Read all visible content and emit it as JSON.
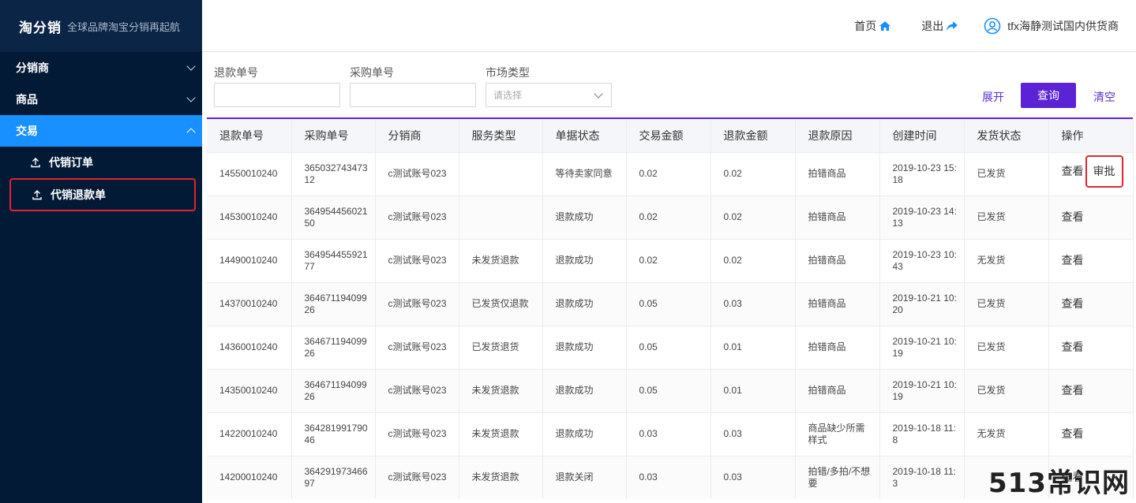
{
  "brand": {
    "logo": "淘分销",
    "subtitle": "全球品牌淘宝分销再起航"
  },
  "sidebar": {
    "groups": [
      {
        "label": "分销商"
      },
      {
        "label": "商品"
      },
      {
        "label": "交易"
      }
    ],
    "sub_items": [
      {
        "label": "代销订单"
      },
      {
        "label": "代销退款单"
      }
    ]
  },
  "header": {
    "home": "首页",
    "logout": "退出",
    "user": "tfx海静测试国内供货商"
  },
  "filters": {
    "refund_no_label": "退款单号",
    "purchase_no_label": "采购单号",
    "market_type_label": "市场类型",
    "market_type_placeholder": "请选择",
    "expand": "展开",
    "query": "查询",
    "clear": "清空"
  },
  "table": {
    "columns": [
      "退款单号",
      "采购单号",
      "分销商",
      "服务类型",
      "单据状态",
      "交易金额",
      "退款金额",
      "退款原因",
      "创建时间",
      "发货状态",
      "操作"
    ],
    "view_label": "查看",
    "approve_label": "审批",
    "rows": [
      [
        "14550010240",
        "36503274347312",
        "c测试账号023",
        "",
        "等待卖家同意",
        "0.02",
        "0.02",
        "拍错商品",
        "2019-10-23 15:18",
        "已发货"
      ],
      [
        "14530010240",
        "36495445602150",
        "c测试账号023",
        "",
        "退款成功",
        "0.02",
        "0.02",
        "拍错商品",
        "2019-10-23 14:13",
        "已发货"
      ],
      [
        "14490010240",
        "36495445592177",
        "c测试账号023",
        "未发货退款",
        "退款成功",
        "0.02",
        "0.02",
        "拍错商品",
        "2019-10-23 10:43",
        "无发货"
      ],
      [
        "14370010240",
        "36467119409926",
        "c测试账号023",
        "已发货仅退款",
        "退款成功",
        "0.05",
        "0.03",
        "拍错商品",
        "2019-10-21 10:20",
        "已发货"
      ],
      [
        "14360010240",
        "36467119409926",
        "c测试账号023",
        "已发货退货",
        "退款成功",
        "0.05",
        "0.01",
        "拍错商品",
        "2019-10-21 10:19",
        "已发货"
      ],
      [
        "14350010240",
        "36467119409926",
        "c测试账号023",
        "未发货退款",
        "退款成功",
        "0.05",
        "0.01",
        "拍错商品",
        "2019-10-21 10:19",
        "已发货"
      ],
      [
        "14220010240",
        "36428199179046",
        "c测试账号023",
        "未发货退款",
        "退款成功",
        "0.03",
        "0.03",
        "商品缺少所需样式",
        "2019-10-18 11:8",
        "无发货"
      ],
      [
        "14200010240",
        "36429197346697",
        "c测试账号023",
        "未发货退款",
        "退款关闭",
        "0.03",
        "0.03",
        "拍错/多拍/不想要",
        "2019-10-18 11:3",
        ""
      ]
    ]
  },
  "watermark": "513常识网",
  "colors": {
    "sidebar_bg": "#031a36",
    "active": "#1890ff",
    "accent": "#5b22d6",
    "highlight": "#e0242f"
  }
}
